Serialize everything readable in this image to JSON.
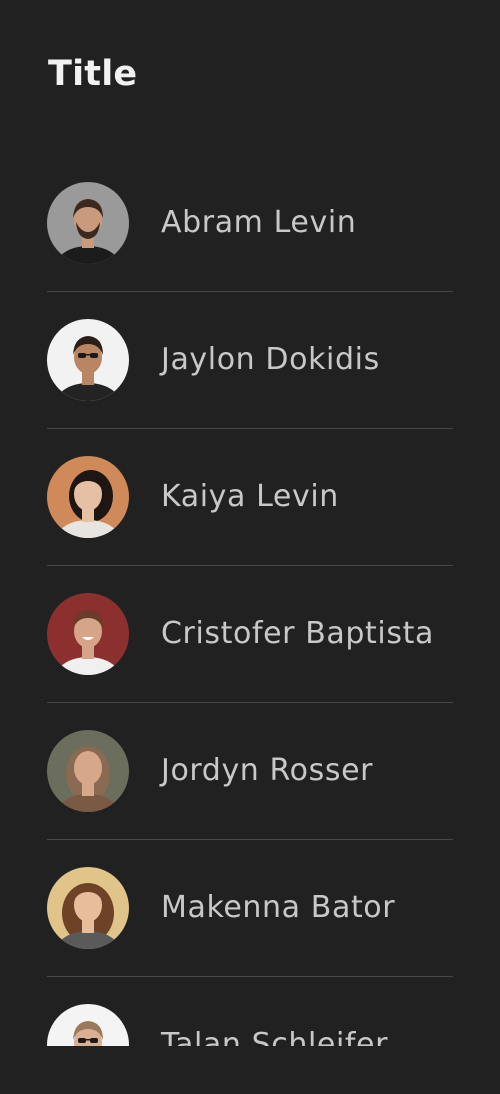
{
  "header": {
    "title": "Title"
  },
  "contacts": [
    {
      "name": "Abram Levin",
      "bg": "#9a9a9a",
      "skin": "#c99a7c",
      "hair": "#3a2a20",
      "shirt": "#1c1c1c",
      "extra": "beard"
    },
    {
      "name": "Jaylon Dokidis",
      "bg": "#f2f2f2",
      "skin": "#b98563",
      "hair": "#2a1e18",
      "shirt": "#232323",
      "extra": "glasses"
    },
    {
      "name": "Kaiya Levin",
      "bg": "#d08a5a",
      "skin": "#e6c0a4",
      "hair": "#1e1612",
      "shirt": "#e8e4df",
      "extra": "none"
    },
    {
      "name": "Cristofer Baptista",
      "bg": "#8b2f2f",
      "skin": "#d6a587",
      "hair": "#6a3a2a",
      "shirt": "#f0f0f0",
      "extra": "smile"
    },
    {
      "name": "Jordyn Rosser",
      "bg": "#6b6e5c",
      "skin": "#d7a789",
      "hair": "#8a6a52",
      "shirt": "#7a5a44",
      "extra": "hijab"
    },
    {
      "name": "Makenna Bator",
      "bg": "#e0c48a",
      "skin": "#e7bd9b",
      "hair": "#6e4226",
      "shirt": "#5a5a5a",
      "extra": "curls"
    },
    {
      "name": "Talan Schleifer",
      "bg": "#f4f4f4",
      "skin": "#d8b094",
      "hair": "#9a7a58",
      "shirt": "#3a3a3a",
      "extra": "glasses"
    }
  ]
}
